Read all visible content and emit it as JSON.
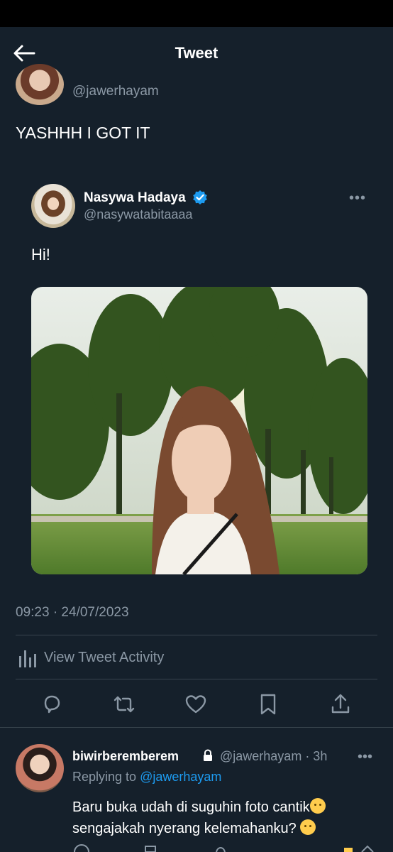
{
  "header": {
    "title": "Tweet",
    "back_icon": "arrow-left-icon"
  },
  "tweet": {
    "handle": "@jawerhayam",
    "text": "YASHHH I GOT IT"
  },
  "quoted_tweet": {
    "name": "Nasywa Hadaya",
    "handle": "@nasywatabitaaaa",
    "text": "Hi!",
    "more": "•••"
  },
  "meta": {
    "timestamp": "09:23 · 24/07/2023",
    "activity_label": "View Tweet Activity"
  },
  "actions": [
    "reply-icon",
    "retweet-icon",
    "like-icon",
    "bookmark-icon",
    "share-icon"
  ],
  "reply": {
    "name": "biwirberemberem",
    "meta": "@jawerhayam · 3h",
    "replying_prefix": "Replying to ",
    "replying_mention": "@jawerhayam",
    "line1": "Baru buka udah di suguhin foto cantik",
    "line2": "sengajakah nyerang kelemahanku? ",
    "more": "•••"
  },
  "colors": {
    "background": "#15202b",
    "accent": "#1d9bf0",
    "muted": "#8b98a5",
    "divider": "#38444d"
  }
}
